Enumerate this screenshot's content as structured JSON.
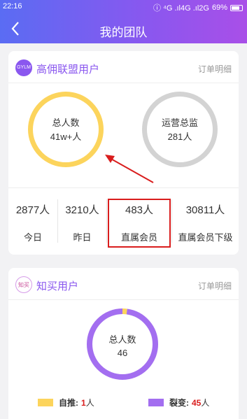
{
  "status": {
    "time": "22:16",
    "network": "ⓘ ⁴G .ıl4G .ıl2G",
    "battery": "69%"
  },
  "header": {
    "title": "我的团队"
  },
  "card1": {
    "logo_text": "GYLM",
    "title": "高佣联盟用户",
    "link": "订单明细",
    "ring_left": {
      "line1": "总人数",
      "line2": "41w+人"
    },
    "ring_right": {
      "line1": "运营总监",
      "line2": "281人"
    },
    "stats": [
      {
        "value": "2877人",
        "label": "今日"
      },
      {
        "value": "3210人",
        "label": "昨日"
      },
      {
        "value": "483人",
        "label": "直属会员"
      },
      {
        "value": "30811人",
        "label": "直属会员下级"
      }
    ]
  },
  "card2": {
    "logo_text": "知买",
    "title": "知买用户",
    "link": "订单明细",
    "total_label": "总人数",
    "total_value": "46",
    "legend": [
      {
        "label": "自推:",
        "count": "1",
        "unit": "人",
        "color": "#fcd45c"
      },
      {
        "label": "裂变:",
        "count": "45",
        "unit": "人",
        "color": "#a36ef0"
      }
    ],
    "donut_fractions": [
      0.0217,
      0.9783
    ]
  },
  "colors": {
    "accent": "#8a57ef",
    "highlight": "#d91d1d",
    "gold": "#fcd45c",
    "gray": "#d3d3d3",
    "purple": "#a36ef0"
  }
}
